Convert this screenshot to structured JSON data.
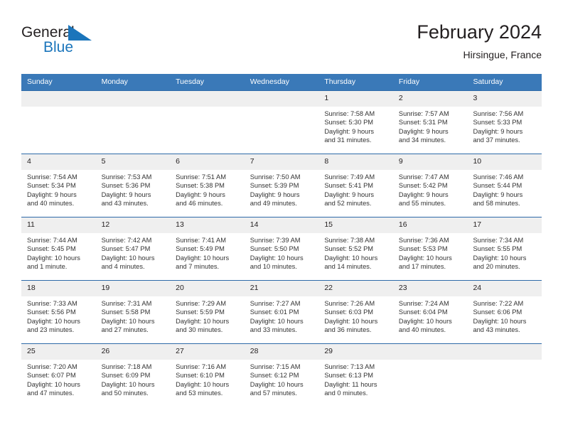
{
  "brand": {
    "general": "General",
    "blue": "Blue",
    "flag_icon": "triangle-flag-icon",
    "accent_color": "#1b75bb"
  },
  "header": {
    "month_title": "February 2024",
    "location": "Hirsingue, France"
  },
  "calendar": {
    "header_bg": "#3a79b8",
    "day_band_bg": "#efefef",
    "row_border_color": "#2e6aa8",
    "weekdays": [
      "Sunday",
      "Monday",
      "Tuesday",
      "Wednesday",
      "Thursday",
      "Friday",
      "Saturday"
    ],
    "weeks": [
      [
        {
          "day": "",
          "sunrise": "",
          "sunset": "",
          "daylight_line1": "",
          "daylight_line2": "",
          "empty": true
        },
        {
          "day": "",
          "sunrise": "",
          "sunset": "",
          "daylight_line1": "",
          "daylight_line2": "",
          "empty": true
        },
        {
          "day": "",
          "sunrise": "",
          "sunset": "",
          "daylight_line1": "",
          "daylight_line2": "",
          "empty": true
        },
        {
          "day": "",
          "sunrise": "",
          "sunset": "",
          "daylight_line1": "",
          "daylight_line2": "",
          "empty": true
        },
        {
          "day": "1",
          "sunrise": "Sunrise: 7:58 AM",
          "sunset": "Sunset: 5:30 PM",
          "daylight_line1": "Daylight: 9 hours",
          "daylight_line2": "and 31 minutes."
        },
        {
          "day": "2",
          "sunrise": "Sunrise: 7:57 AM",
          "sunset": "Sunset: 5:31 PM",
          "daylight_line1": "Daylight: 9 hours",
          "daylight_line2": "and 34 minutes."
        },
        {
          "day": "3",
          "sunrise": "Sunrise: 7:56 AM",
          "sunset": "Sunset: 5:33 PM",
          "daylight_line1": "Daylight: 9 hours",
          "daylight_line2": "and 37 minutes."
        }
      ],
      [
        {
          "day": "4",
          "sunrise": "Sunrise: 7:54 AM",
          "sunset": "Sunset: 5:34 PM",
          "daylight_line1": "Daylight: 9 hours",
          "daylight_line2": "and 40 minutes."
        },
        {
          "day": "5",
          "sunrise": "Sunrise: 7:53 AM",
          "sunset": "Sunset: 5:36 PM",
          "daylight_line1": "Daylight: 9 hours",
          "daylight_line2": "and 43 minutes."
        },
        {
          "day": "6",
          "sunrise": "Sunrise: 7:51 AM",
          "sunset": "Sunset: 5:38 PM",
          "daylight_line1": "Daylight: 9 hours",
          "daylight_line2": "and 46 minutes."
        },
        {
          "day": "7",
          "sunrise": "Sunrise: 7:50 AM",
          "sunset": "Sunset: 5:39 PM",
          "daylight_line1": "Daylight: 9 hours",
          "daylight_line2": "and 49 minutes."
        },
        {
          "day": "8",
          "sunrise": "Sunrise: 7:49 AM",
          "sunset": "Sunset: 5:41 PM",
          "daylight_line1": "Daylight: 9 hours",
          "daylight_line2": "and 52 minutes."
        },
        {
          "day": "9",
          "sunrise": "Sunrise: 7:47 AM",
          "sunset": "Sunset: 5:42 PM",
          "daylight_line1": "Daylight: 9 hours",
          "daylight_line2": "and 55 minutes."
        },
        {
          "day": "10",
          "sunrise": "Sunrise: 7:46 AM",
          "sunset": "Sunset: 5:44 PM",
          "daylight_line1": "Daylight: 9 hours",
          "daylight_line2": "and 58 minutes."
        }
      ],
      [
        {
          "day": "11",
          "sunrise": "Sunrise: 7:44 AM",
          "sunset": "Sunset: 5:45 PM",
          "daylight_line1": "Daylight: 10 hours",
          "daylight_line2": "and 1 minute."
        },
        {
          "day": "12",
          "sunrise": "Sunrise: 7:42 AM",
          "sunset": "Sunset: 5:47 PM",
          "daylight_line1": "Daylight: 10 hours",
          "daylight_line2": "and 4 minutes."
        },
        {
          "day": "13",
          "sunrise": "Sunrise: 7:41 AM",
          "sunset": "Sunset: 5:49 PM",
          "daylight_line1": "Daylight: 10 hours",
          "daylight_line2": "and 7 minutes."
        },
        {
          "day": "14",
          "sunrise": "Sunrise: 7:39 AM",
          "sunset": "Sunset: 5:50 PM",
          "daylight_line1": "Daylight: 10 hours",
          "daylight_line2": "and 10 minutes."
        },
        {
          "day": "15",
          "sunrise": "Sunrise: 7:38 AM",
          "sunset": "Sunset: 5:52 PM",
          "daylight_line1": "Daylight: 10 hours",
          "daylight_line2": "and 14 minutes."
        },
        {
          "day": "16",
          "sunrise": "Sunrise: 7:36 AM",
          "sunset": "Sunset: 5:53 PM",
          "daylight_line1": "Daylight: 10 hours",
          "daylight_line2": "and 17 minutes."
        },
        {
          "day": "17",
          "sunrise": "Sunrise: 7:34 AM",
          "sunset": "Sunset: 5:55 PM",
          "daylight_line1": "Daylight: 10 hours",
          "daylight_line2": "and 20 minutes."
        }
      ],
      [
        {
          "day": "18",
          "sunrise": "Sunrise: 7:33 AM",
          "sunset": "Sunset: 5:56 PM",
          "daylight_line1": "Daylight: 10 hours",
          "daylight_line2": "and 23 minutes."
        },
        {
          "day": "19",
          "sunrise": "Sunrise: 7:31 AM",
          "sunset": "Sunset: 5:58 PM",
          "daylight_line1": "Daylight: 10 hours",
          "daylight_line2": "and 27 minutes."
        },
        {
          "day": "20",
          "sunrise": "Sunrise: 7:29 AM",
          "sunset": "Sunset: 5:59 PM",
          "daylight_line1": "Daylight: 10 hours",
          "daylight_line2": "and 30 minutes."
        },
        {
          "day": "21",
          "sunrise": "Sunrise: 7:27 AM",
          "sunset": "Sunset: 6:01 PM",
          "daylight_line1": "Daylight: 10 hours",
          "daylight_line2": "and 33 minutes."
        },
        {
          "day": "22",
          "sunrise": "Sunrise: 7:26 AM",
          "sunset": "Sunset: 6:03 PM",
          "daylight_line1": "Daylight: 10 hours",
          "daylight_line2": "and 36 minutes."
        },
        {
          "day": "23",
          "sunrise": "Sunrise: 7:24 AM",
          "sunset": "Sunset: 6:04 PM",
          "daylight_line1": "Daylight: 10 hours",
          "daylight_line2": "and 40 minutes."
        },
        {
          "day": "24",
          "sunrise": "Sunrise: 7:22 AM",
          "sunset": "Sunset: 6:06 PM",
          "daylight_line1": "Daylight: 10 hours",
          "daylight_line2": "and 43 minutes."
        }
      ],
      [
        {
          "day": "25",
          "sunrise": "Sunrise: 7:20 AM",
          "sunset": "Sunset: 6:07 PM",
          "daylight_line1": "Daylight: 10 hours",
          "daylight_line2": "and 47 minutes."
        },
        {
          "day": "26",
          "sunrise": "Sunrise: 7:18 AM",
          "sunset": "Sunset: 6:09 PM",
          "daylight_line1": "Daylight: 10 hours",
          "daylight_line2": "and 50 minutes."
        },
        {
          "day": "27",
          "sunrise": "Sunrise: 7:16 AM",
          "sunset": "Sunset: 6:10 PM",
          "daylight_line1": "Daylight: 10 hours",
          "daylight_line2": "and 53 minutes."
        },
        {
          "day": "28",
          "sunrise": "Sunrise: 7:15 AM",
          "sunset": "Sunset: 6:12 PM",
          "daylight_line1": "Daylight: 10 hours",
          "daylight_line2": "and 57 minutes."
        },
        {
          "day": "29",
          "sunrise": "Sunrise: 7:13 AM",
          "sunset": "Sunset: 6:13 PM",
          "daylight_line1": "Daylight: 11 hours",
          "daylight_line2": "and 0 minutes."
        },
        {
          "day": "",
          "sunrise": "",
          "sunset": "",
          "daylight_line1": "",
          "daylight_line2": "",
          "empty": true
        },
        {
          "day": "",
          "sunrise": "",
          "sunset": "",
          "daylight_line1": "",
          "daylight_line2": "",
          "empty": true
        }
      ]
    ]
  }
}
